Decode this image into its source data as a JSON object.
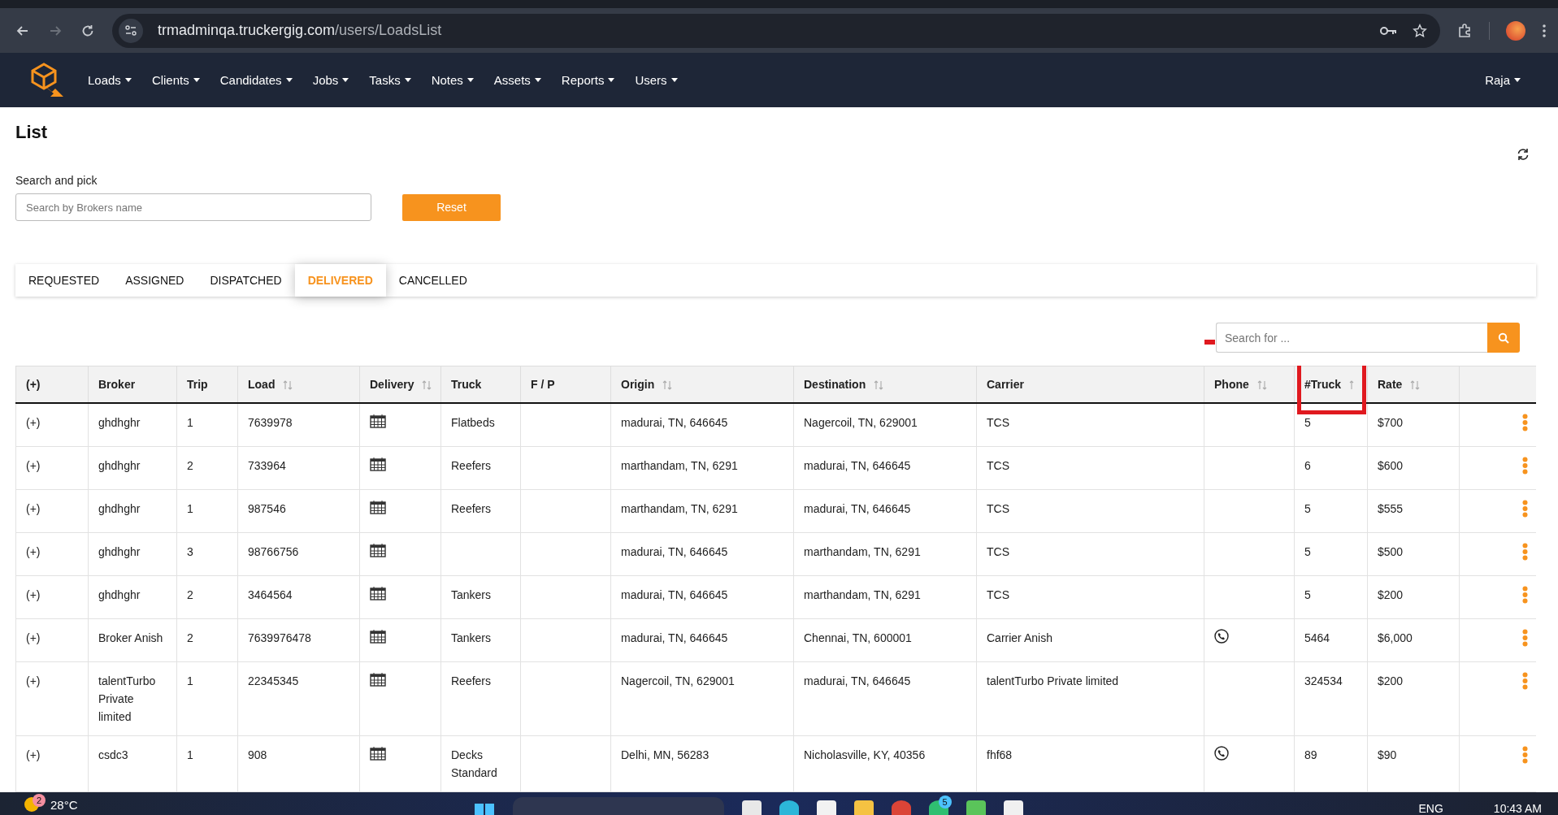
{
  "browser": {
    "url_host": "trmadminqa.truckergig.com",
    "url_path": "/users/LoadsList",
    "forward_disabled": true
  },
  "nav": {
    "menus": [
      "Loads",
      "Clients",
      "Candidates",
      "Jobs",
      "Tasks",
      "Notes",
      "Assets",
      "Reports",
      "Users"
    ],
    "user": "Raja"
  },
  "page": {
    "title": "List",
    "search_label": "Search and pick",
    "search_placeholder": "Search by Brokers name",
    "reset_button": "Reset"
  },
  "tabs": [
    {
      "label": "REQUESTED",
      "selected": false
    },
    {
      "label": "ASSIGNED",
      "selected": false
    },
    {
      "label": "DISPATCHED",
      "selected": false
    },
    {
      "label": "DELIVERED",
      "selected": true
    },
    {
      "label": "CANCELLED",
      "selected": false
    }
  ],
  "table_search": {
    "placeholder": "Search for ..."
  },
  "table": {
    "columns": [
      {
        "label": "(+)",
        "sortable": false
      },
      {
        "label": "Broker",
        "sortable": false
      },
      {
        "label": "Trip",
        "sortable": false
      },
      {
        "label": "Load",
        "sortable": true,
        "sorted": false
      },
      {
        "label": "Delivery",
        "sortable": true,
        "sorted": false
      },
      {
        "label": "Truck",
        "sortable": false
      },
      {
        "label": "F / P",
        "sortable": false
      },
      {
        "label": "Origin",
        "sortable": true,
        "sorted": false
      },
      {
        "label": "Destination",
        "sortable": true,
        "sorted": false
      },
      {
        "label": "Carrier",
        "sortable": false
      },
      {
        "label": "Phone",
        "sortable": true,
        "sorted": false
      },
      {
        "label": "#Truck",
        "sortable": true,
        "sorted": true
      },
      {
        "label": "Rate",
        "sortable": true,
        "sorted": false
      }
    ],
    "rows": [
      {
        "expand": "(+)",
        "broker": "ghdhghr",
        "trip": "1",
        "load": "7639978",
        "truck": "Flatbeds",
        "origin": "madurai, TN, 646645",
        "destination": "Nagercoil, TN, 629001",
        "carrier": "TCS",
        "phone": false,
        "trucks": "5",
        "rate": "$700"
      },
      {
        "expand": "(+)",
        "broker": "ghdhghr",
        "trip": "2",
        "load": "733964",
        "truck": "Reefers",
        "origin": "marthandam, TN, 6291",
        "destination": "madurai, TN, 646645",
        "carrier": "TCS",
        "phone": false,
        "trucks": "6",
        "rate": "$600"
      },
      {
        "expand": "(+)",
        "broker": "ghdhghr",
        "trip": "1",
        "load": "987546",
        "truck": "Reefers",
        "origin": "marthandam, TN, 6291",
        "destination": "madurai, TN, 646645",
        "carrier": "TCS",
        "phone": false,
        "trucks": "5",
        "rate": "$555"
      },
      {
        "expand": "(+)",
        "broker": "ghdhghr",
        "trip": "3",
        "load": "98766756",
        "origin": "madurai, TN, 646645",
        "destination": "marthandam, TN, 6291",
        "carrier": "TCS",
        "phone": false,
        "trucks": "5",
        "rate": "$500"
      },
      {
        "expand": "(+)",
        "broker": "ghdhghr",
        "trip": "2",
        "load": "3464564",
        "truck": "Tankers",
        "origin": "madurai, TN, 646645",
        "destination": "marthandam, TN, 6291",
        "carrier": "TCS",
        "phone": false,
        "trucks": "5",
        "rate": "$200"
      },
      {
        "expand": "(+)",
        "broker": "Broker Anish",
        "trip": "2",
        "load": "7639976478",
        "truck": "Tankers",
        "origin": "madurai, TN, 646645",
        "destination": "Chennai, TN, 600001",
        "carrier": "Carrier Anish",
        "phone": true,
        "trucks": "5464",
        "rate": "$6,000"
      },
      {
        "expand": "(+)",
        "broker": "talentTurbo Private limited",
        "trip": "1",
        "load": "22345345",
        "truck": "Reefers",
        "origin": "Nagercoil, TN, 629001",
        "destination": "madurai, TN, 646645",
        "carrier": "talentTurbo Private limited",
        "phone": false,
        "trucks": "324534",
        "rate": "$200"
      },
      {
        "expand": "(+)",
        "broker": "csdc3",
        "trip": "1",
        "load": "908",
        "truck": "Decks Standard",
        "origin": "Delhi, MN, 56283",
        "destination": "Nicholasville, KY, 40356",
        "carrier": "fhf68",
        "phone": true,
        "trucks": "89",
        "rate": "$90"
      }
    ]
  },
  "taskbar": {
    "weather_badge": "2",
    "temperature": "28°C",
    "chat_badge": "5",
    "language": "ENG",
    "time": "10:43 AM"
  }
}
